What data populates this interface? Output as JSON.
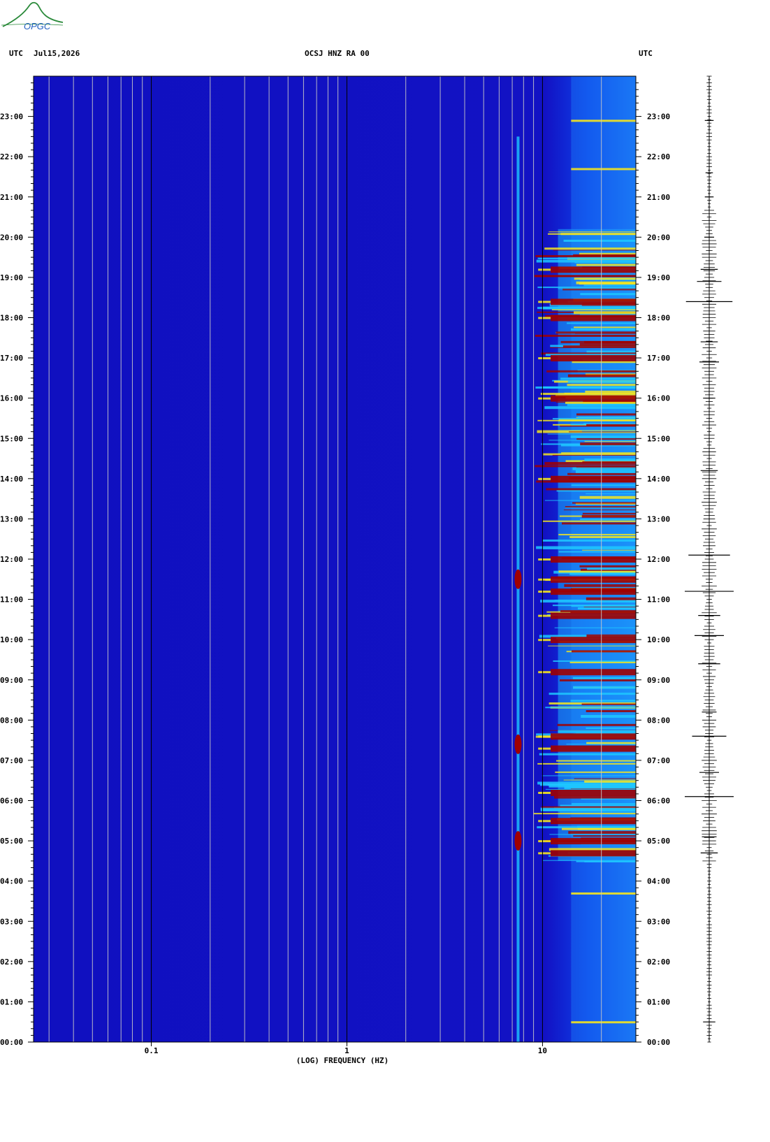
{
  "logo": {
    "text": "OPGC"
  },
  "header": {
    "left_tz": "UTC",
    "date": "Jul15,2026",
    "title": "OCSJ HNZ RA 00",
    "right_tz": "UTC"
  },
  "chart_data": {
    "type": "heatmap",
    "title": "OCSJ HNZ RA 00",
    "xlabel": "(LOG) FREQUENCY (HZ)",
    "x_scale": "log",
    "xlim": [
      0.025,
      30
    ],
    "x_ticks": [
      {
        "value": 0.1,
        "label": "0.1"
      },
      {
        "value": 1,
        "label": "1"
      },
      {
        "value": 10,
        "label": "10"
      }
    ],
    "ylabel": "UTC",
    "ylim_hours": [
      0,
      24
    ],
    "y_ticks": [
      "00:00",
      "01:00",
      "02:00",
      "03:00",
      "04:00",
      "05:00",
      "06:00",
      "07:00",
      "08:00",
      "09:00",
      "10:00",
      "11:00",
      "12:00",
      "13:00",
      "14:00",
      "15:00",
      "16:00",
      "17:00",
      "18:00",
      "19:00",
      "20:00",
      "21:00",
      "22:00",
      "23:00"
    ],
    "grid": true,
    "colors": {
      "background": "#1515c8",
      "low": "#0a2ad8",
      "mid": "#1ec8ff",
      "high": "#f5e61e",
      "peak": "#a00000"
    },
    "energy_band_hz": [
      7,
      30
    ],
    "persistent_line_hz": 7.5,
    "active_period_hours": [
      4.5,
      20.2
    ],
    "strong_event_hours": [
      4.7,
      5.0,
      5.5,
      6.2,
      7.3,
      7.6,
      9.2,
      10.0,
      10.6,
      11.2,
      11.5,
      12.0,
      14.0,
      16.0,
      17.0,
      18.0,
      18.4,
      19.2
    ]
  },
  "trace": {
    "events": [
      {
        "hour": 0.5,
        "amp": 0.25
      },
      {
        "hour": 4.7,
        "amp": 0.35
      },
      {
        "hour": 5.1,
        "amp": 0.3
      },
      {
        "hour": 6.1,
        "amp": 1.0
      },
      {
        "hour": 6.7,
        "amp": 0.4
      },
      {
        "hour": 7.6,
        "amp": 0.7
      },
      {
        "hour": 8.2,
        "amp": 0.3
      },
      {
        "hour": 9.4,
        "amp": 0.45
      },
      {
        "hour": 10.1,
        "amp": 0.6
      },
      {
        "hour": 10.6,
        "amp": 0.45
      },
      {
        "hour": 11.2,
        "amp": 1.0
      },
      {
        "hour": 12.1,
        "amp": 0.85
      },
      {
        "hour": 14.2,
        "amp": 0.35
      },
      {
        "hour": 16.0,
        "amp": 0.25
      },
      {
        "hour": 16.9,
        "amp": 0.4
      },
      {
        "hour": 17.4,
        "amp": 0.35
      },
      {
        "hour": 18.4,
        "amp": 0.95
      },
      {
        "hour": 18.9,
        "amp": 0.5
      },
      {
        "hour": 19.2,
        "amp": 0.35
      },
      {
        "hour": 20.0,
        "amp": 0.2
      },
      {
        "hour": 21.0,
        "amp": 0.18
      },
      {
        "hour": 21.6,
        "amp": 0.15
      },
      {
        "hour": 22.9,
        "amp": 0.18
      }
    ]
  }
}
